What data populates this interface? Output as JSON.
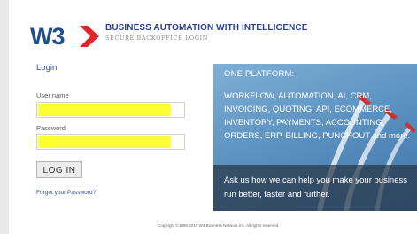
{
  "header": {
    "logo_text": "W3",
    "tagline": "BUSINESS AUTOMATION WITH INTELLIGENCE",
    "subtagline": "SECURE BACKOFFICE LOGIN"
  },
  "login": {
    "title": "Login",
    "username_label": "User name",
    "username_value": "",
    "password_label": "Password",
    "password_value": "",
    "autofill_color": "#ffff33",
    "button_label": "LOG IN",
    "forgot_link": "Forgot your Password?"
  },
  "promo": {
    "heading": "ONE PLATFORM:",
    "body": "WORKFLOW, AUTOMATION, AI, CRM, INVOICING, QUOTING, API, ECOMMERCE, INVENTORY, PAYMENTS, ACCOUNTING, ORDERS, ERP, BILLING, PUNCHOUT and more.",
    "cta": "Ask us how we can help you make your business run better, faster and further."
  },
  "footer": {
    "copyright": "Copyright ©1995-2019 W3 Business Network Inc. All rights reserved."
  },
  "colors": {
    "brand_blue": "#1f4e8c",
    "brand_red": "#e0262b",
    "link_blue": "#2f4f9e"
  }
}
